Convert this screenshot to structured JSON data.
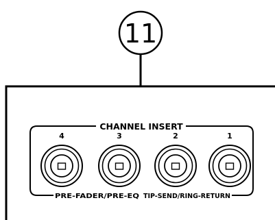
{
  "callout": {
    "number": "11"
  },
  "insert_section": {
    "title": "CHANNEL INSERT",
    "jacks": [
      {
        "number": "4"
      },
      {
        "number": "3"
      },
      {
        "number": "2"
      },
      {
        "number": "1"
      }
    ],
    "label_left": "PRE-FADER/PRE-EQ",
    "label_right": "TIP-SEND/RING-RETURN"
  }
}
